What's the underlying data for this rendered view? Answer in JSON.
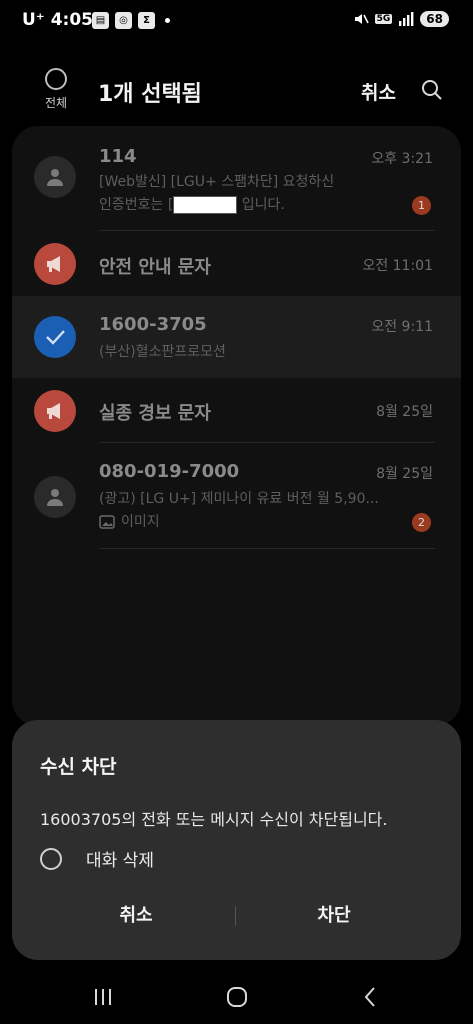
{
  "status": {
    "carrier": "U⁺ 4:05",
    "battery": "68",
    "network": "5G"
  },
  "header": {
    "select_all_label": "전체",
    "title": "1개 선택됨",
    "cancel_label": "취소"
  },
  "messages": [
    {
      "sender": "114",
      "time": "오후 3:21",
      "preview_line1": "[Web발신] [LGU+ 스팸차단] 요청하신",
      "preview_line2_pre": "인증번호는 [",
      "preview_line2_post": "입니다.",
      "badge": "1",
      "avatar": "person-icon"
    },
    {
      "sender": "안전 안내 문자",
      "time": "오전 11:01",
      "avatar": "megaphone-icon"
    },
    {
      "sender": "1600-3705",
      "time": "오전 9:11",
      "preview_line1": "(부산)혈소판프로모션",
      "avatar": "check-icon",
      "selected": true
    },
    {
      "sender": "실종 경보 문자",
      "time": "8월 25일",
      "avatar": "megaphone-icon"
    },
    {
      "sender": "080-019-7000",
      "time": "8월 25일",
      "preview_line1": "(광고) [LG U+] 제미나이 유료 버전 월 5,90...",
      "preview_line2": "이미지",
      "badge": "2",
      "avatar": "person-icon"
    }
  ],
  "dialog": {
    "title": "수신 차단",
    "message": "16003705의 전화 또는 메시지 수신이 차단됩니다.",
    "option_label": "대화 삭제",
    "cancel_label": "취소",
    "block_label": "차단"
  },
  "colors": {
    "background": "#000000",
    "list_bg": "#111111",
    "dialog_bg": "#2e2e2e",
    "selected_check": "#1a5fb4",
    "alert_avatar": "#b8493c",
    "badge": "#9a3a1e"
  }
}
